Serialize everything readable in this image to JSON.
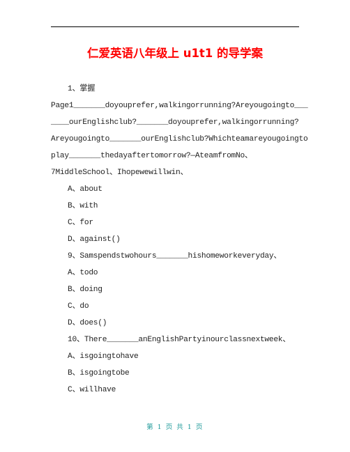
{
  "document": {
    "title": "仁爱英语八年级上 u1t1 的导学案",
    "lines": [
      {
        "text": "1、掌握",
        "indent": true
      },
      {
        "text": "Page1_______doyouprefer,walkingorrunning?Areyougoingto___",
        "indent": false
      },
      {
        "text": "____ourEnglishclub?_______doyouprefer,walkingorrunning?",
        "indent": false
      },
      {
        "text": "Areyougoingto_______ourEnglishclub?Whichteamareyougoingto",
        "indent": false
      },
      {
        "text": "play_______thedayaftertomorrow?—AteamfromNo、",
        "indent": false
      },
      {
        "text": "7MiddleSchool、Ihopewewillwin、",
        "indent": false
      },
      {
        "text": "A、about",
        "indent": true
      },
      {
        "text": "B、with",
        "indent": true
      },
      {
        "text": "C、for",
        "indent": true
      },
      {
        "text": "D、against()",
        "indent": true
      },
      {
        "text": "9、Samspendstwohours_______hishomeworkeveryday、",
        "indent": true
      },
      {
        "text": "A、todo",
        "indent": true
      },
      {
        "text": "B、doing",
        "indent": true
      },
      {
        "text": "C、do",
        "indent": true
      },
      {
        "text": "D、does()",
        "indent": true
      },
      {
        "text": "10、There_______anEnglishPartyinourclassnextweek、",
        "indent": true
      },
      {
        "text": "A、isgoingtohave",
        "indent": true
      },
      {
        "text": "B、isgoingtobe",
        "indent": true
      },
      {
        "text": "C、willhave",
        "indent": true
      }
    ],
    "footer": "第 1 页 共 1 页"
  },
  "colors": {
    "title": "#ff0000",
    "footer": "#1f9a9a",
    "body_text": "#222222"
  }
}
